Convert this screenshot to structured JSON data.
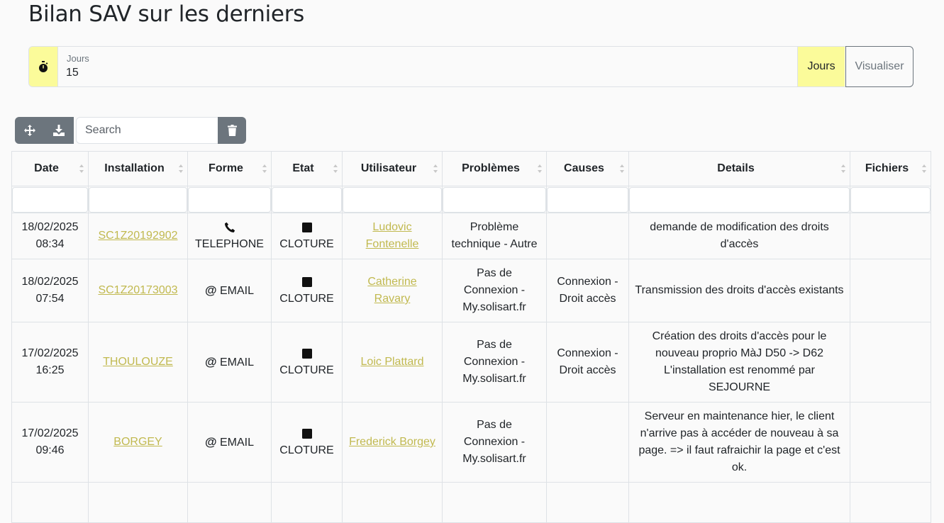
{
  "page": {
    "title": "Bilan SAV sur les derniers"
  },
  "days_filter": {
    "label": "Jours",
    "value": "15",
    "unit": "Jours",
    "submit_label": "Visualiser"
  },
  "toolbar": {
    "search_placeholder": "Search"
  },
  "table": {
    "columns": [
      "Date",
      "Installation",
      "Forme",
      "Etat",
      "Utilisateur",
      "Problèmes",
      "Causes",
      "Details",
      "Fichiers"
    ],
    "rows": [
      {
        "date": "18/02/2025",
        "time": "08:34",
        "installation": "SC1Z20192902",
        "forme_icon": "phone-icon",
        "forme": "TELEPHONE",
        "etat": "CLOTURE",
        "user_line1": "Ludovic",
        "user_line2": "Fontenelle",
        "probleme": "Problème technique - Autre",
        "cause": "",
        "details": "demande de modification des droits d'accès",
        "fichiers": ""
      },
      {
        "date": "18/02/2025",
        "time": "07:54",
        "installation": "SC1Z20173003",
        "forme_icon": "at-icon",
        "forme": "EMAIL",
        "etat": "CLOTURE",
        "user_line1": "Catherine Ravary",
        "user_line2": "",
        "probleme": "Pas de Connexion - My.solisart.fr",
        "cause": "Connexion - Droit accès",
        "details": "Transmission des droits d'accès existants",
        "fichiers": ""
      },
      {
        "date": "17/02/2025",
        "time": "16:25",
        "installation": "THOULOUZE",
        "forme_icon": "at-icon",
        "forme": "EMAIL",
        "etat": "CLOTURE",
        "user_line1": "Loic Plattard",
        "user_line2": "",
        "probleme": "Pas de Connexion - My.solisart.fr",
        "cause": "Connexion - Droit accès",
        "details": "Création des droits d'accès pour le nouveau proprio MàJ D50 -> D62 L'installation est renommé par SEJOURNE",
        "fichiers": ""
      },
      {
        "date": "17/02/2025",
        "time": "09:46",
        "installation": "BORGEY",
        "forme_icon": "at-icon",
        "forme": "EMAIL",
        "etat": "CLOTURE",
        "user_line1": "Frederick Borgey",
        "user_line2": "",
        "probleme": "Pas de Connexion - My.solisart.fr",
        "cause": "",
        "details": "Serveur en maintenance hier, le client n'arrive pas à accéder de nouveau à sa page. => il faut rafraichir la page et c'est ok.",
        "fichiers": ""
      }
    ]
  },
  "colors": {
    "accent_yellow": "#fbfb9a",
    "link": "#c1b94f",
    "button_gray": "#6c757d"
  }
}
